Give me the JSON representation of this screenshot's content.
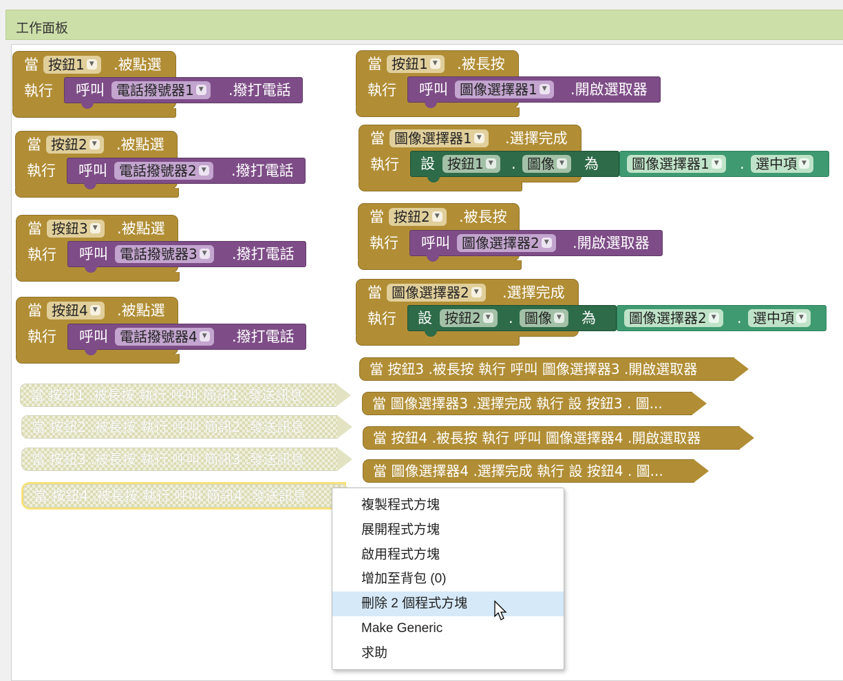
{
  "panel": {
    "title": "工作面板"
  },
  "kw": {
    "when": "當",
    "do": "執行",
    "call": "呼叫",
    "set": "設",
    "to": "為",
    "dot": "."
  },
  "left_events": [
    {
      "button": "按鈕1",
      "event": ".被點選",
      "component": "電話撥號器1",
      "method": ".撥打電話"
    },
    {
      "button": "按鈕2",
      "event": ".被點選",
      "component": "電話撥號器2",
      "method": ".撥打電話"
    },
    {
      "button": "按鈕3",
      "event": ".被點選",
      "component": "電話撥號器3",
      "method": ".撥打電話"
    },
    {
      "button": "按鈕4",
      "event": ".被點選",
      "component": "電話撥號器4",
      "method": ".撥打電話"
    }
  ],
  "right_longpress": [
    {
      "button": "按鈕1",
      "event": ".被長按",
      "component": "圖像選擇器1",
      "method": ".開啟選取器"
    },
    {
      "button": "按鈕2",
      "event": ".被長按",
      "component": "圖像選擇器2",
      "method": ".開啟選取器"
    }
  ],
  "right_picker": [
    {
      "picker": "圖像選擇器1",
      "event": ".選擇完成",
      "set_component": "按鈕1",
      "set_property": "圖像",
      "get_component": "圖像選擇器1",
      "get_property": "選中項"
    },
    {
      "picker": "圖像選擇器2",
      "event": ".選擇完成",
      "set_component": "按鈕2",
      "set_property": "圖像",
      "get_component": "圖像選擇器2",
      "get_property": "選中項"
    }
  ],
  "collapsed_right": [
    "當 按鈕3 .被長按 執行 呼叫 圖像選擇器3 .開啟選取器",
    "當 圖像選擇器3 .選擇完成 執行 設 按鈕3 . 圖...",
    "當 按鈕4 .被長按 執行 呼叫 圖像選擇器4 .開啟選取器",
    "當 圖像選擇器4 .選擇完成 執行 設 按鈕4 . 圖..."
  ],
  "collapsed_disabled": [
    "當 按鈕1 .被長按 執行 呼叫 簡訊1 .發送訊息",
    "當 按鈕2 .被長按 執行 呼叫 簡訊2 .發送訊息",
    "當 按鈕3 .被長按 執行 呼叫 簡訊3 .發送訊息",
    "當 按鈕4 .被長按 執行 呼叫 簡訊4 .發送訊息"
  ],
  "context_menu": {
    "items": [
      "複製程式方塊",
      "展開程式方塊",
      "啟用程式方塊",
      "增加至背包 (0)",
      "刪除 2 個程式方塊",
      "Make Generic",
      "求助"
    ],
    "highlighted": "刪除 2 個程式方塊"
  },
  "colors": {
    "event": "#b18e35",
    "call": "#7e4d87",
    "setter": "#2e6b48",
    "getter": "#3f9a72",
    "header": "#cddfa9",
    "menu_highlight": "#d6e9f8"
  }
}
